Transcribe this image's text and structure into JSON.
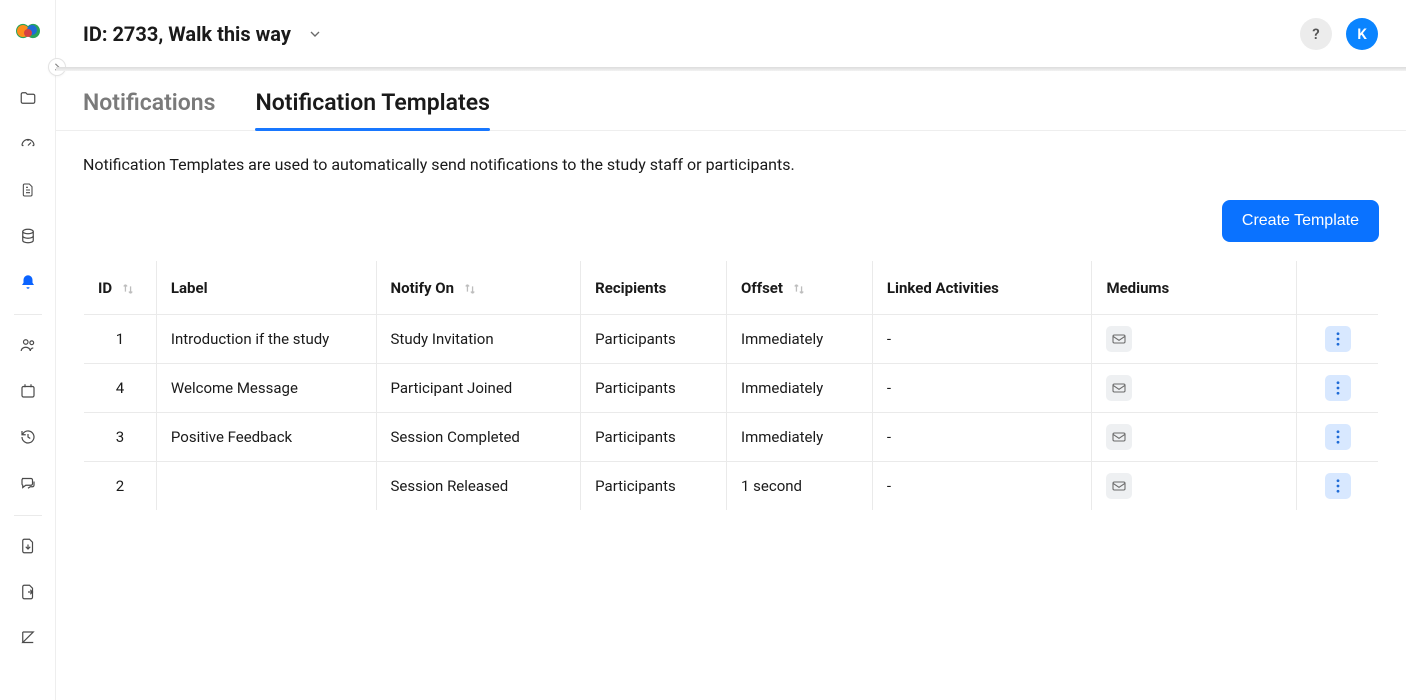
{
  "header": {
    "id_label": "ID: 2733,",
    "name": "Walk this way",
    "avatar_initial": "K",
    "help": "?"
  },
  "tabs": [
    {
      "id": "notifications",
      "label": "Notifications",
      "active": false
    },
    {
      "id": "templates",
      "label": "Notification Templates",
      "active": true
    }
  ],
  "description": "Notification Templates are used to automatically send notifications to the study staff or participants.",
  "toolbar": {
    "create_label": "Create Template"
  },
  "table": {
    "columns": {
      "id": "ID",
      "label": "Label",
      "notify_on": "Notify On",
      "recipients": "Recipients",
      "offset": "Offset",
      "linked_activities": "Linked Activities",
      "mediums": "Mediums"
    },
    "rows": [
      {
        "id": "1",
        "label": "Introduction if the study",
        "notify_on": "Study Invitation",
        "recipients": "Participants",
        "offset": "Immediately",
        "linked": "-",
        "mediums": [
          "email"
        ]
      },
      {
        "id": "4",
        "label": "Welcome Message",
        "notify_on": "Participant Joined",
        "recipients": "Participants",
        "offset": "Immediately",
        "linked": "-",
        "mediums": [
          "email"
        ]
      },
      {
        "id": "3",
        "label": "Positive Feedback",
        "notify_on": "Session Completed",
        "recipients": "Participants",
        "offset": "Immediately",
        "linked": "-",
        "mediums": [
          "email"
        ]
      },
      {
        "id": "2",
        "label": "",
        "notify_on": "Session Released",
        "recipients": "Participants",
        "offset": "1 second",
        "linked": "-",
        "mediums": [
          "email"
        ]
      }
    ]
  },
  "sidebar": {
    "items": [
      {
        "id": "folder",
        "icon": "folder-icon"
      },
      {
        "id": "dashboard",
        "icon": "gauge-icon"
      },
      {
        "id": "document",
        "icon": "document-icon"
      },
      {
        "id": "data",
        "icon": "database-icon"
      },
      {
        "id": "notify",
        "icon": "bell-icon",
        "active": true
      }
    ],
    "items2": [
      {
        "id": "users",
        "icon": "users-icon"
      },
      {
        "id": "schedule",
        "icon": "calendar-icon"
      },
      {
        "id": "history",
        "icon": "history-icon"
      },
      {
        "id": "chat",
        "icon": "chat-icon"
      }
    ],
    "items3": [
      {
        "id": "export",
        "icon": "file-export-icon"
      },
      {
        "id": "import",
        "icon": "file-import-icon"
      },
      {
        "id": "kotlin",
        "icon": "k-icon"
      }
    ]
  }
}
